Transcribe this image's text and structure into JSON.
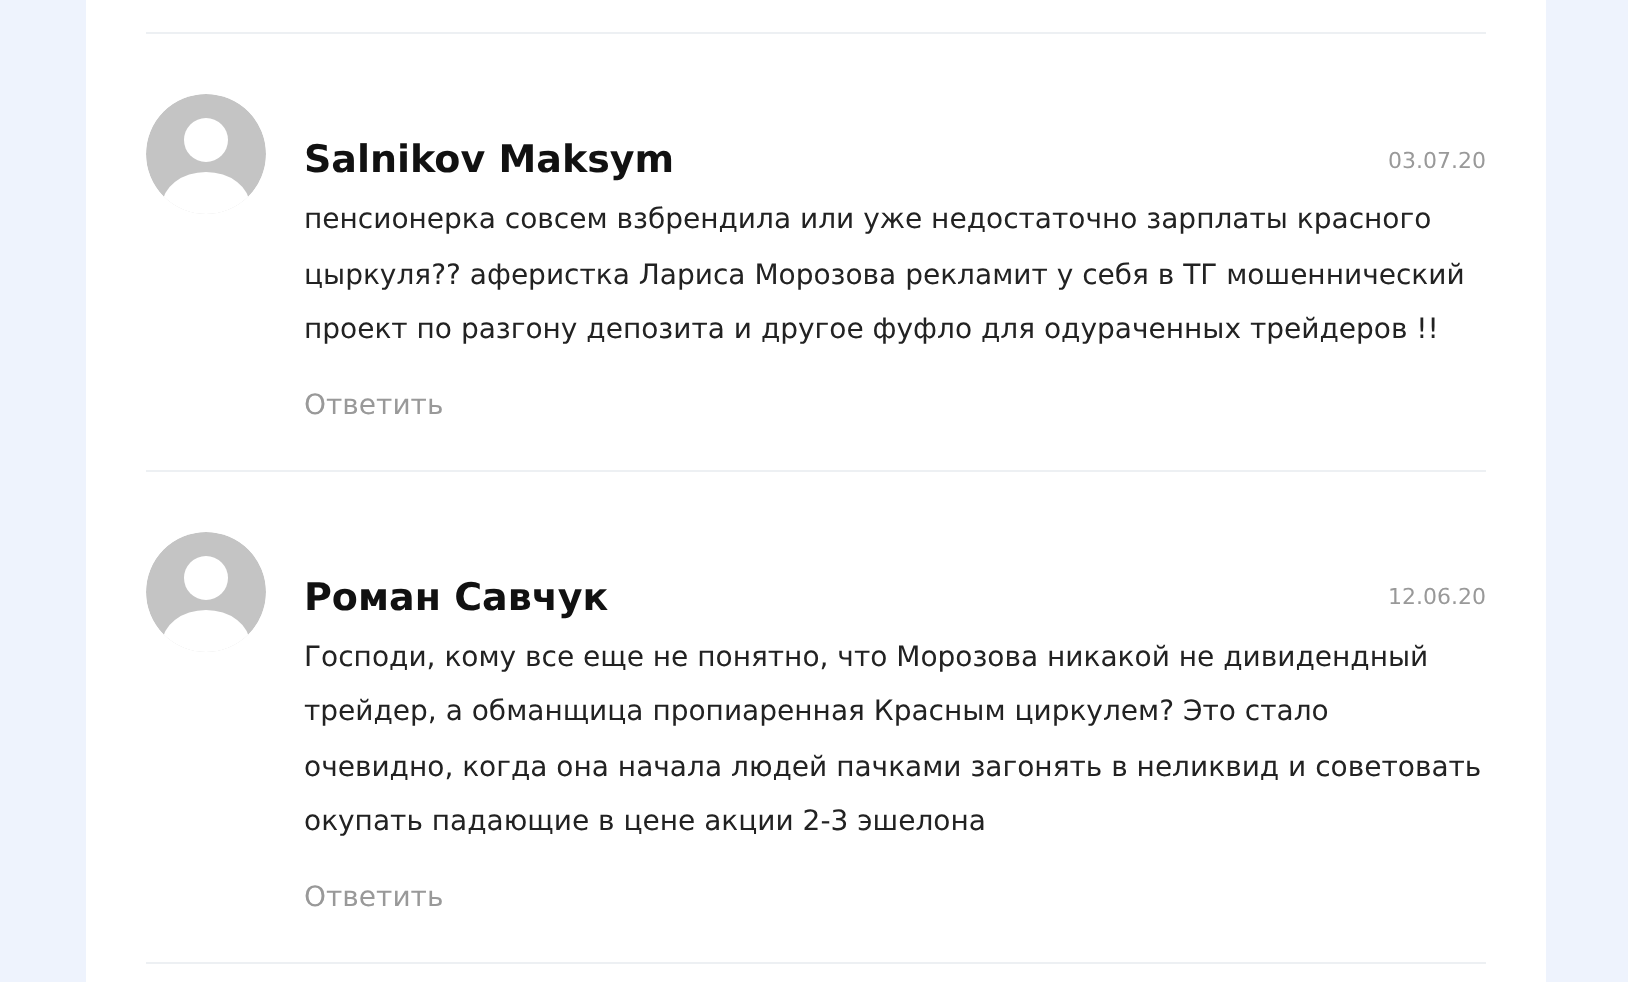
{
  "comments": [
    {
      "author": "Salnikov Maksym",
      "date": "03.07.20",
      "text": "пенсионерка совсем взбрендила или уже недостаточно зарплаты красного цыркуля?? аферистка Лариса Морозова рекламит у себя в ТГ мошеннический проект по разгону депозита и другое фуфло для одураченных трейдеров !!",
      "reply": "Ответить"
    },
    {
      "author": "Роман Савчук",
      "date": "12.06.20",
      "text": "Господи, кому все еще не понятно, что Морозова никакой не дивидендный трейдер, а обманщица пропиаренная Красным циркулем? Это стало очевидно, когда она начала людей пачками загонять в неликвид и советовать окупать падающие в цене акции 2-3 эшелона",
      "reply": "Ответить"
    }
  ]
}
